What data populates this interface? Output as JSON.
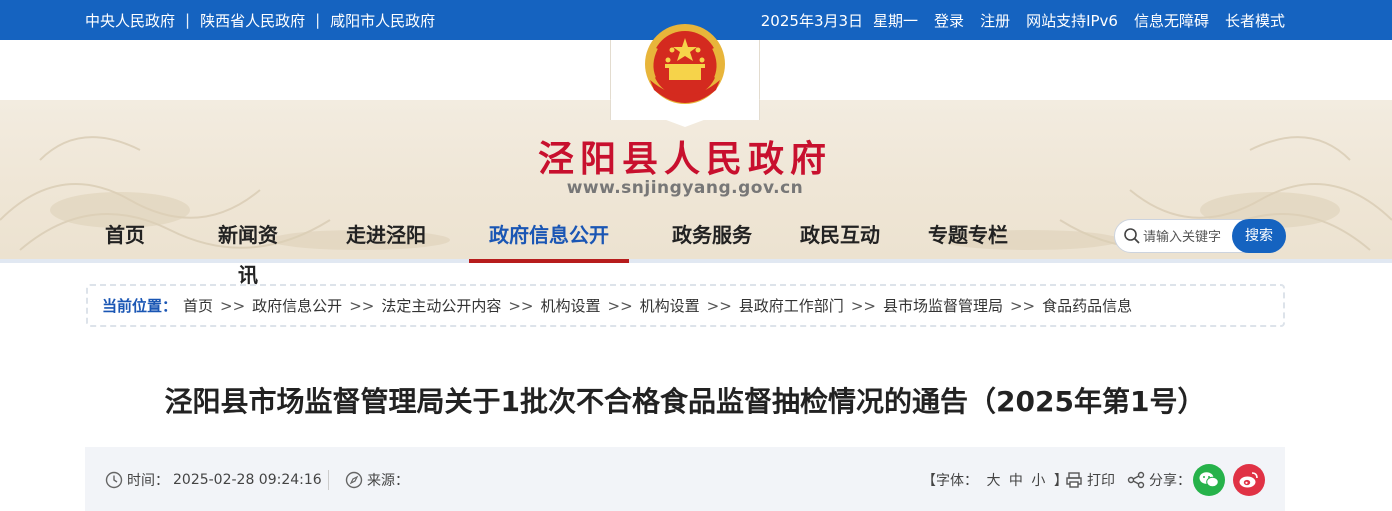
{
  "topbar": {
    "links": [
      "中央人民政府",
      "陕西省人民政府",
      "咸阳市人民政府"
    ],
    "separator": "|",
    "date": "2025年3月3日",
    "weekday": "星期一",
    "login": "登录",
    "register": "注册",
    "ipv6": "网站支持IPv6",
    "accessible": "信息无障碍",
    "elder_mode": "长者模式"
  },
  "header": {
    "site_title": "泾阳县人民政府",
    "site_url": "www.snjingyang.gov.cn"
  },
  "nav": {
    "items": [
      "首页",
      "新闻资讯",
      "走进泾阳",
      "政府信息公开",
      "政务服务",
      "政民互动",
      "专题专栏"
    ],
    "active_index": 3
  },
  "search": {
    "placeholder": "请输入关键字",
    "button": "搜索"
  },
  "breadcrumb": {
    "label": "当前位置：",
    "arrow": ">>",
    "items": [
      "首页",
      "政府信息公开",
      "法定主动公开内容",
      "机构设置",
      "机构设置",
      "县政府工作部门",
      "县市场监督管理局",
      "食品药品信息"
    ]
  },
  "article": {
    "title": "泾阳县市场监督管理局关于1批次不合格食品监督抽检情况的通告（2025年第1号）",
    "time_label": "时间：",
    "time": "2025-02-28 09:24:16",
    "source_label": "来源：",
    "font_label_open": "【字体：",
    "font_sizes": [
      "大",
      "中",
      "小"
    ],
    "font_label_close": "】",
    "print": "打印",
    "share": "分享："
  },
  "icons": {
    "clock": "clock-icon",
    "compass": "compass-icon",
    "print": "printer-icon",
    "share": "share-icon",
    "wechat": "wechat-icon",
    "weibo": "weibo-icon",
    "search": "search-icon",
    "emblem": "national-emblem"
  },
  "colors": {
    "topbar": "#1563c0",
    "title_red": "#c8102e",
    "active_blue": "#1a56b4",
    "active_underline": "#b71c1c"
  }
}
